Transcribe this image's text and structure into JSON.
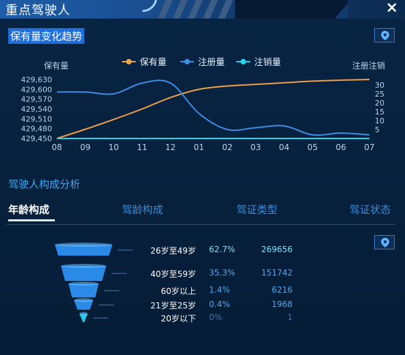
{
  "window": {
    "title": "重点驾驶人",
    "close_icon": "×"
  },
  "trend": {
    "title": "保有量变化趋势",
    "left_axis_label": "保有量",
    "right_axis_label": "注册注销",
    "legend": [
      "保有量",
      "注册量",
      "注销量"
    ]
  },
  "chart_data": {
    "type": "line",
    "x": [
      "08",
      "09",
      "10",
      "11",
      "12",
      "01",
      "02",
      "03",
      "04",
      "05",
      "06",
      "07"
    ],
    "series": [
      {
        "name": "保有量",
        "axis": "left",
        "color": "#f2a24a",
        "values": [
          429450,
          429478,
          429508,
          429540,
          429575,
          429600,
          429610,
          429615,
          429620,
          429625,
          429628,
          429630
        ]
      },
      {
        "name": "注册量",
        "axis": "right",
        "color": "#3f8fe8",
        "values": [
          26,
          26,
          25,
          31,
          31,
          14,
          5,
          6,
          7,
          2,
          3,
          2
        ]
      },
      {
        "name": "注销量",
        "axis": "right",
        "color": "#27d7f0",
        "values": [
          0,
          0,
          0,
          0,
          0,
          0,
          0,
          0,
          0,
          0,
          0,
          0
        ]
      }
    ],
    "left_yticks": [
      "429,630",
      "429,600",
      "429,570",
      "429,540",
      "429,510",
      "429,480",
      "429,450"
    ],
    "left_ylim": [
      429450,
      429630
    ],
    "right_yticks": [
      "30",
      "25",
      "20",
      "15",
      "10",
      "5"
    ],
    "right_ylim": [
      0,
      33
    ]
  },
  "composition": {
    "title": "驾驶人构成分析",
    "tabs": [
      "年龄构成",
      "驾龄构成",
      "驾证类型",
      "驾证状态"
    ],
    "active_tab": 0,
    "rows": [
      {
        "label": "26岁至49岁",
        "pct": "62.7%",
        "count": "269656",
        "color": "#2d8ff0"
      },
      {
        "label": "40岁至59岁",
        "pct": "35.3%",
        "count": "151742",
        "color": "#2d8ff0"
      },
      {
        "label": "60岁以上",
        "pct": "1.4%",
        "count": "6216",
        "color": "#2d8ff0"
      },
      {
        "label": "21岁至25岁",
        "pct": "0.4%",
        "count": "1968",
        "color": "#2d8ff0"
      },
      {
        "label": "20岁以下",
        "pct": "0%",
        "count": "1",
        "color": "#22d3ee"
      }
    ]
  }
}
